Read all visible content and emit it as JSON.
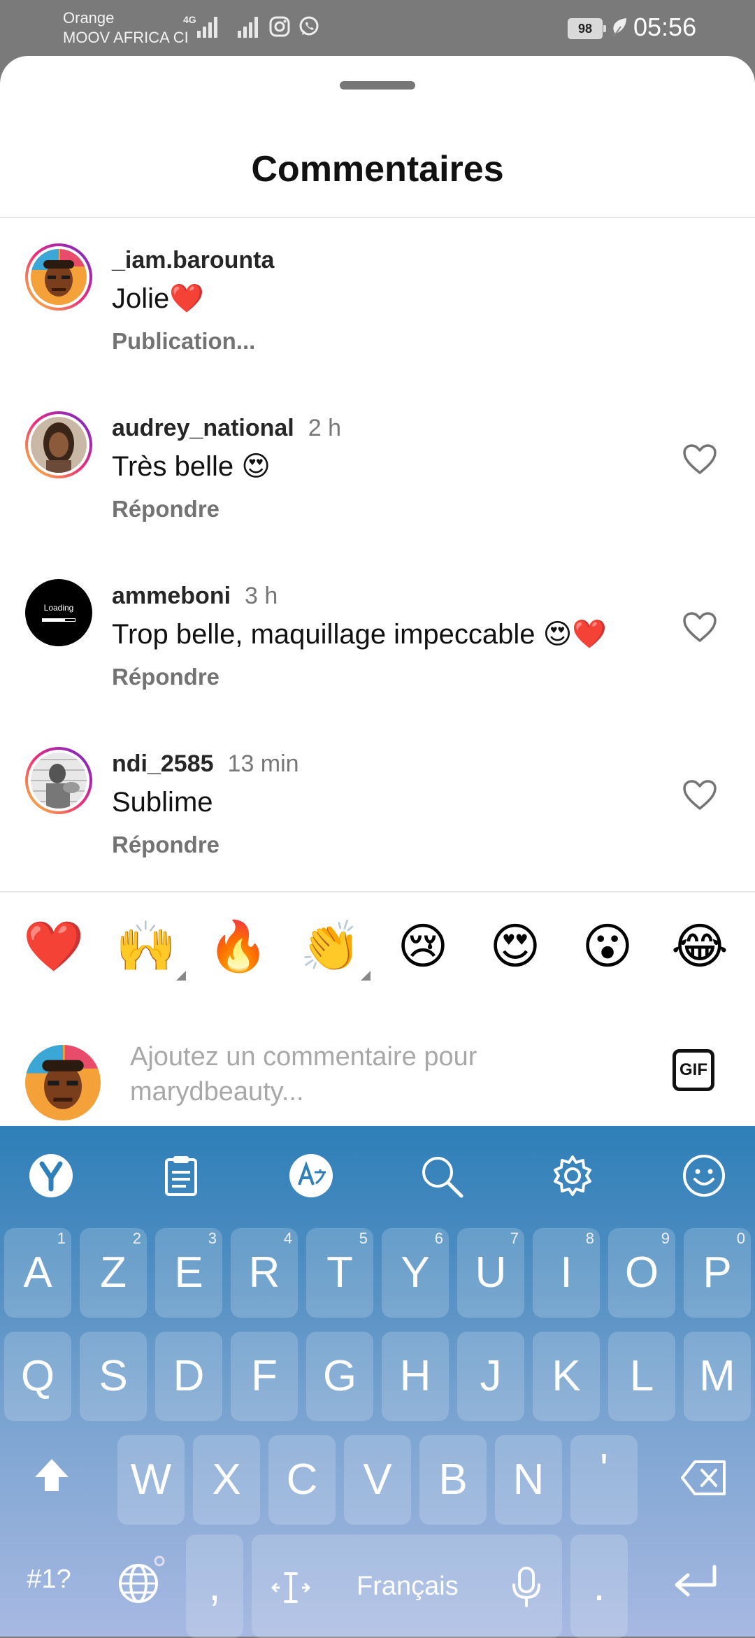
{
  "status_bar": {
    "carrier_1": "Orange",
    "carrier_2": "MOOV AFRICA CI",
    "network": "4G",
    "battery": "98",
    "time": "05:56"
  },
  "sheet": {
    "title": "Commentaires"
  },
  "comments": [
    {
      "username": "_iam.barounta",
      "time": "",
      "text": "Jolie❤️",
      "action": "Publication...",
      "has_like": false
    },
    {
      "username": "audrey_national",
      "time": "2 h",
      "text": "Très belle 😍",
      "action": "Répondre",
      "has_like": true
    },
    {
      "username": "ammeboni",
      "time": "3 h",
      "text": "Trop belle, maquillage impeccable 😍❤️",
      "action": "Répondre",
      "has_like": true,
      "avatar_text": "Loading"
    },
    {
      "username": "ndi_2585",
      "time": "13 min",
      "text": "Sublime",
      "action": "Répondre",
      "has_like": true
    }
  ],
  "quick_reactions": [
    "❤️",
    "🙌",
    "🔥",
    "👏",
    "😢",
    "😍",
    "😮",
    "😂"
  ],
  "composer": {
    "placeholder": "Ajoutez un commentaire pour marydbeauty...",
    "gif_label": "GIF"
  },
  "keyboard": {
    "row1": [
      {
        "key": "A",
        "num": "1"
      },
      {
        "key": "Z",
        "num": "2"
      },
      {
        "key": "E",
        "num": "3"
      },
      {
        "key": "R",
        "num": "4"
      },
      {
        "key": "T",
        "num": "5"
      },
      {
        "key": "Y",
        "num": "6"
      },
      {
        "key": "U",
        "num": "7"
      },
      {
        "key": "I",
        "num": "8"
      },
      {
        "key": "O",
        "num": "9"
      },
      {
        "key": "P",
        "num": "0"
      }
    ],
    "row2": [
      "Q",
      "S",
      "D",
      "F",
      "G",
      "H",
      "J",
      "K",
      "L",
      "M"
    ],
    "row3": [
      "W",
      "X",
      "C",
      "V",
      "B",
      "N",
      "'"
    ],
    "symbols_label": "#1?",
    "comma": ",",
    "space_label": "Français",
    "period": "."
  },
  "colors": {
    "accent_heart": "#e0182d",
    "keyboard_top": "#2f7fb9",
    "keyboard_bottom": "#a7b9e2"
  }
}
